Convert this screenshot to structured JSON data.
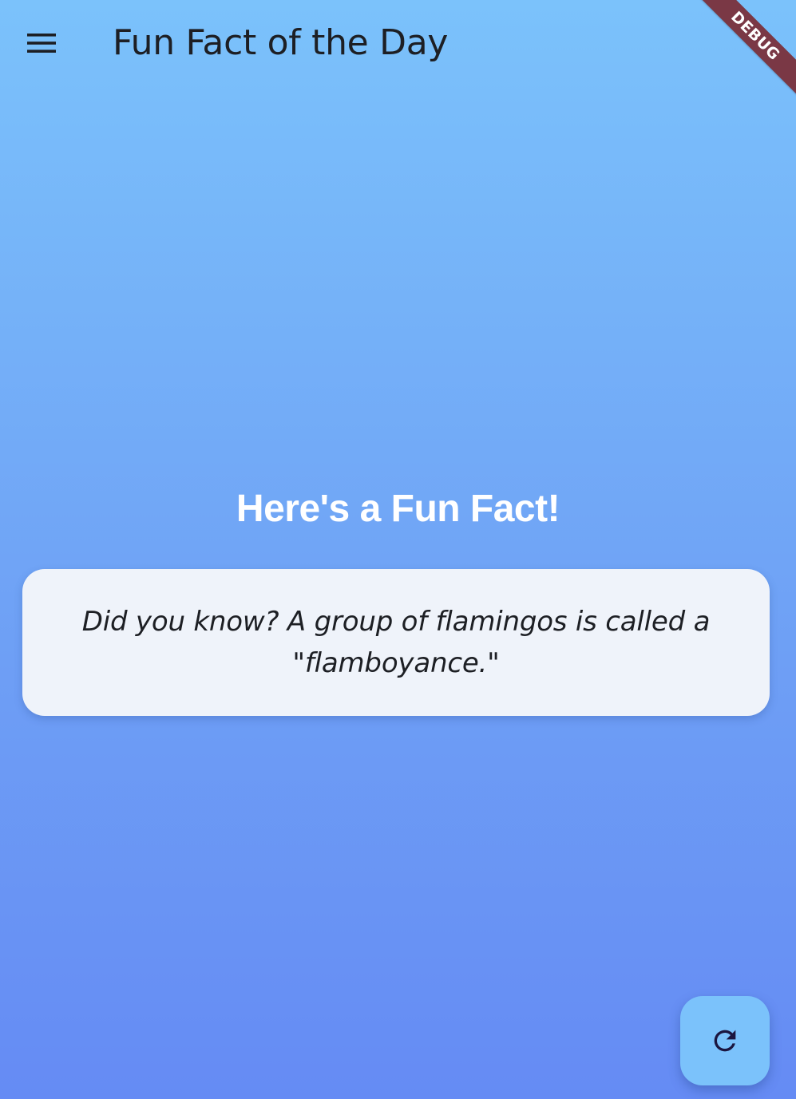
{
  "app_bar": {
    "title": "Fun Fact of the Day",
    "menu_icon": "menu-icon"
  },
  "debug_banner": {
    "label": "DEBUG",
    "color": "#7a3845"
  },
  "main": {
    "headline": "Here's a Fun Fact!",
    "fact": "Did you know? A group of flamingos is called a \"flamboyance.\""
  },
  "fab": {
    "icon": "refresh-icon",
    "color": "#7bc2fb"
  },
  "colors": {
    "background_top": "#7bc2fb",
    "background_bottom": "#658bf4",
    "card": "#eff3fa",
    "text_dark": "#1d1f24",
    "headline": "#ffffff"
  }
}
